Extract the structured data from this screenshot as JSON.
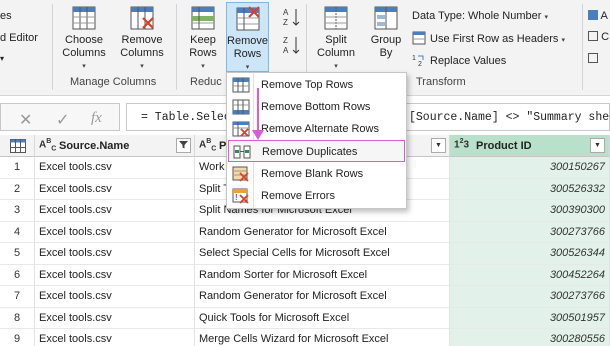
{
  "ribbon": {
    "left_partial": {
      "line1": "es",
      "line2": "d Editor"
    },
    "choose_columns": {
      "line1": "Choose",
      "line2": "Columns"
    },
    "remove_columns": {
      "line1": "Remove",
      "line2": "Columns"
    },
    "manage_columns_label": "Manage Columns",
    "keep_rows": {
      "line1": "Keep",
      "line2": "Rows"
    },
    "remove_rows": {
      "line1": "Remove",
      "line2": "Rows"
    },
    "reduce_label": "Reduc",
    "split_column": {
      "line1": "Split",
      "line2": "Column"
    },
    "group_by": {
      "line1": "Group",
      "line2": "By"
    },
    "data_type": "Data Type: Whole Number",
    "use_first_row": "Use First Row as Headers",
    "replace_values": "Replace Values",
    "transform_label": "Transform",
    "right_partial_1": "A",
    "right_partial_2": "C",
    "sort_az": "A Z",
    "sort_za": "Z A"
  },
  "formula_bar": {
    "cancel": "✕",
    "confirm": "✓",
    "fx": "fx",
    "formula_left": "= Table.SelectR",
    "formula_right": "[Source.Name] <> \"Summary sheet"
  },
  "menu": {
    "items": [
      {
        "label": "Remove Top Rows",
        "icon": "remove-top-rows-icon"
      },
      {
        "label": "Remove Bottom Rows",
        "icon": "remove-bottom-rows-icon"
      },
      {
        "label": "Remove Alternate Rows",
        "icon": "remove-alternate-rows-icon"
      },
      {
        "label": "Remove Duplicates",
        "icon": "remove-duplicates-icon"
      },
      {
        "label": "Remove Blank Rows",
        "icon": "remove-blank-rows-icon"
      },
      {
        "label": "Remove Errors",
        "icon": "remove-errors-icon"
      }
    ],
    "active_index": 3
  },
  "grid": {
    "headers": {
      "source_type": "A B C",
      "source": "Source.Name",
      "product_type": "A B C",
      "product_partial": "P",
      "product_id_type": "1 2 3",
      "product_id": "Product ID"
    },
    "rows": [
      {
        "n": "1",
        "source": "Excel tools.csv",
        "product": "Work",
        "id": "300150267"
      },
      {
        "n": "2",
        "source": "Excel tools.csv",
        "product": "Split T",
        "id": "300526332"
      },
      {
        "n": "3",
        "source": "Excel tools.csv",
        "product": "Split Names for Microsoft Excel",
        "id": "300390300"
      },
      {
        "n": "4",
        "source": "Excel tools.csv",
        "product": "Random Generator for Microsoft Excel",
        "id": "300273766"
      },
      {
        "n": "5",
        "source": "Excel tools.csv",
        "product": "Select Special Cells for Microsoft Excel",
        "id": "300526344"
      },
      {
        "n": "6",
        "source": "Excel tools.csv",
        "product": "Random Sorter for Microsoft Excel",
        "id": "300452264"
      },
      {
        "n": "7",
        "source": "Excel tools.csv",
        "product": "Random Generator for Microsoft Excel",
        "id": "300273766"
      },
      {
        "n": "8",
        "source": "Excel tools.csv",
        "product": "Quick Tools for Microsoft Excel",
        "id": "300501957"
      },
      {
        "n": "9",
        "source": "Excel tools.csv",
        "product": "Merge Cells Wizard for Microsoft Excel",
        "id": "300280556"
      }
    ]
  },
  "colors": {
    "accent_pink": "#e05ad6",
    "pid_header": "#b9e0cb",
    "pid_cell": "#e2f2ea",
    "highlight": "#cde6f7"
  }
}
